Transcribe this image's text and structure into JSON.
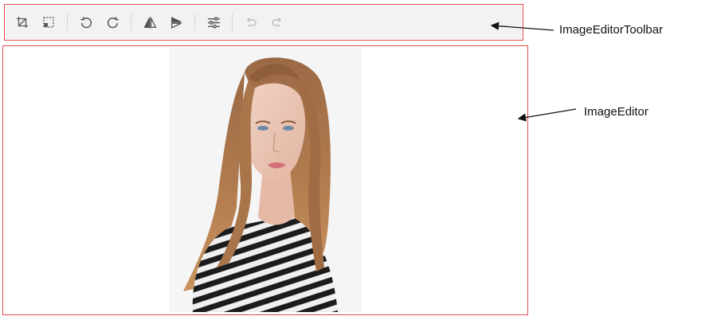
{
  "toolbar": {
    "buttons": [
      {
        "name": "crop-icon",
        "enabled": true
      },
      {
        "name": "select-crop-icon",
        "enabled": true
      },
      {
        "name": "rotate-left-icon",
        "enabled": true
      },
      {
        "name": "rotate-right-icon",
        "enabled": true
      },
      {
        "name": "flip-horizontal-icon",
        "enabled": true
      },
      {
        "name": "flip-vertical-icon",
        "enabled": true
      },
      {
        "name": "adjustments-icon",
        "enabled": true
      },
      {
        "name": "undo-icon",
        "enabled": false
      },
      {
        "name": "redo-icon",
        "enabled": false
      }
    ]
  },
  "annotations": {
    "toolbar_label": "ImageEditorToolbar",
    "editor_label": "ImageEditor"
  },
  "colors": {
    "highlight_border": "#e8474b",
    "toolbar_bg": "#f2f2f2",
    "icon": "#555555",
    "icon_disabled": "#bdbdbd"
  }
}
